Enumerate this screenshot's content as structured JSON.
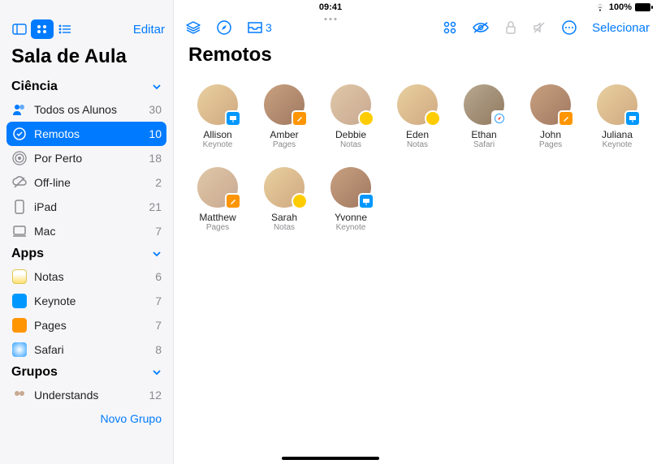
{
  "status": {
    "time": "09:41",
    "battery": "100%"
  },
  "sidebar": {
    "edit": "Editar",
    "title": "Sala de Aula",
    "sections": [
      {
        "title": "Ciência",
        "items": [
          {
            "icon": "people",
            "label": "Todos os Alunos",
            "count": "30"
          },
          {
            "icon": "remote",
            "label": "Remotos",
            "count": "10",
            "selected": true
          },
          {
            "icon": "nearby",
            "label": "Por Perto",
            "count": "18"
          },
          {
            "icon": "offline",
            "label": "Off-line",
            "count": "2"
          },
          {
            "icon": "ipad",
            "label": "iPad",
            "count": "21"
          },
          {
            "icon": "mac",
            "label": "Mac",
            "count": "7"
          }
        ]
      },
      {
        "title": "Apps",
        "items": [
          {
            "icon": "notes",
            "label": "Notas",
            "count": "6"
          },
          {
            "icon": "keynote",
            "label": "Keynote",
            "count": "7"
          },
          {
            "icon": "pages",
            "label": "Pages",
            "count": "7"
          },
          {
            "icon": "safari",
            "label": "Safari",
            "count": "8"
          }
        ]
      },
      {
        "title": "Grupos",
        "items": [
          {
            "icon": "group",
            "label": "Understands",
            "count": "12"
          }
        ]
      }
    ],
    "newGroup": "Novo Grupo"
  },
  "main": {
    "inboxCount": "3",
    "select": "Selecionar",
    "title": "Remotos",
    "students": [
      {
        "name": "Allison",
        "app": "Keynote",
        "badge": "keynote",
        "c": "c1"
      },
      {
        "name": "Amber",
        "app": "Pages",
        "badge": "pages",
        "c": "c2"
      },
      {
        "name": "Debbie",
        "app": "Notas",
        "badge": "notes",
        "c": "c3"
      },
      {
        "name": "Eden",
        "app": "Notas",
        "badge": "notes",
        "c": "c1"
      },
      {
        "name": "Ethan",
        "app": "Safari",
        "badge": "safari",
        "c": "c4"
      },
      {
        "name": "John",
        "app": "Pages",
        "badge": "pages",
        "c": "c2"
      },
      {
        "name": "Juliana",
        "app": "Keynote",
        "badge": "keynote",
        "c": "c1"
      },
      {
        "name": "Matthew",
        "app": "Pages",
        "badge": "pages",
        "c": "c3"
      },
      {
        "name": "Sarah",
        "app": "Notas",
        "badge": "notes",
        "c": "c1"
      },
      {
        "name": "Yvonne",
        "app": "Keynote",
        "badge": "keynote",
        "c": "c2"
      }
    ]
  }
}
